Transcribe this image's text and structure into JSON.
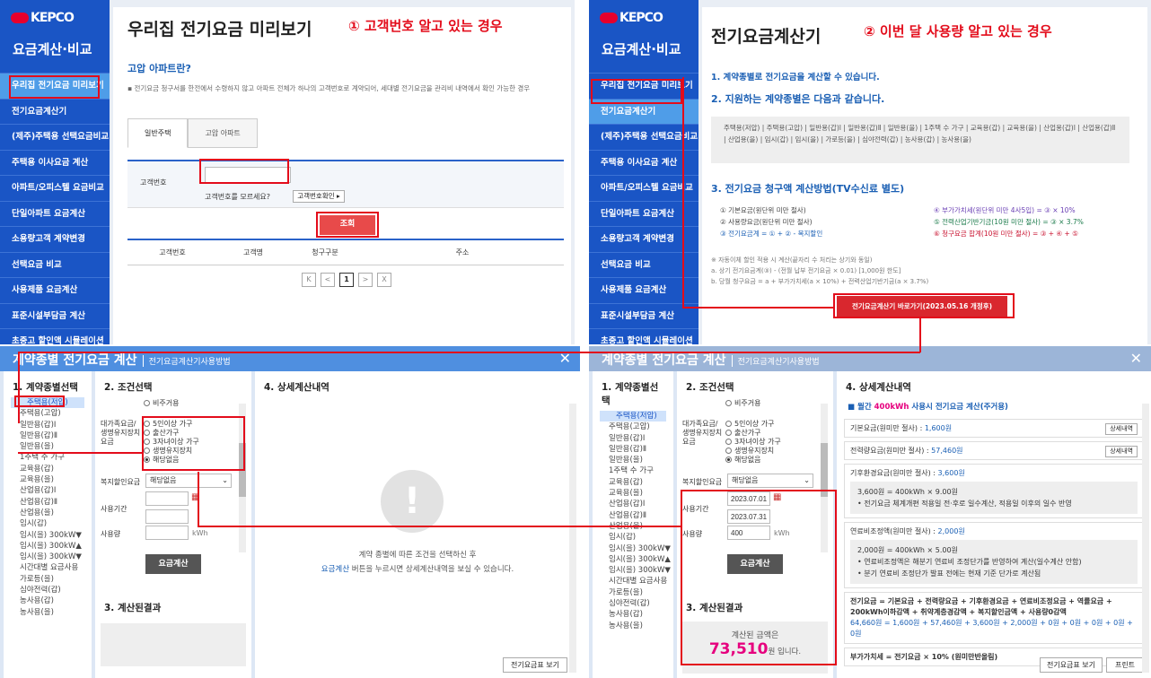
{
  "brand": {
    "logo": "KEPCO",
    "menu_title": "요금계산·비교"
  },
  "left_menu": [
    "우리집 전기요금 미리보기",
    "전기요금계산기",
    "(제주)주택용 선택요금비교",
    "주택용 이사요금 계산",
    "아파트/오피스텔 요금비교",
    "단일아파트 요금계산",
    "소용량고객 계약변경",
    "선택요금 비교",
    "사용제품 요금계산",
    "표준시설부담금 계산",
    "초중고 할인액 시뮬레이션"
  ],
  "right_menu": [
    "우리집 전기요금 미리보기",
    "전기요금계산기",
    "(제주)주택용 선택요금비교",
    "주택용 이사요금 계산",
    "아파트/오피스텔 요금비교",
    "단일아파트 요금계산",
    "소용량고객 계약변경",
    "선택요금 비교",
    "사용제품 요금계산",
    "표준시설부담금 계산",
    "초중고 할인액 시뮬레이션"
  ],
  "p1": {
    "title": "우리집 전기요금 미리보기",
    "callout": "① 고객번호 알고 있는 경우",
    "subtitle": "고압 아파트란?",
    "desc": "▪ 전기요금 청구서를 한전에서 수령하지 않고 아파트 전체가 하나의 고객번호로 계약되어, 세대별 전기요금을 관리비 내역에서 확인 가능한 경우",
    "tabs": [
      "일반주택",
      "고압 아파트"
    ],
    "field_label": "고객번호",
    "hint": "고객번호를 모르세요?",
    "hint_btn": "고객번호확인 ▸",
    "search_btn": "조회",
    "cols": [
      "고객번호",
      "고객명",
      "청구구분",
      "주소"
    ],
    "pager": [
      "K",
      "<",
      "1",
      ">",
      "X"
    ]
  },
  "p2": {
    "title": "전기요금계산기",
    "callout": "② 이번 달 사용량 알고 있는 경우",
    "s1": "1. 계약종별로 전기요금을 계산할 수 있습니다.",
    "s2": "2. 지원하는 계약종별은 다음과 같습니다.",
    "types": "주택용(저압) | 주택용(고압) | 일반용(갑)Ⅰ | 일반용(갑)Ⅱ | 일반용(을) | 1주택 수 가구 | 교육용(갑) | 교육용(을) | 산업용(갑)Ⅰ | 산업용(갑)Ⅱ | 산업용(을) | 임시(갑) | 임시(을) | 가로등(을) | 심야전력(갑) | 농사용(갑) | 농사용(을)",
    "s3": "3. 전기요금 청구액 계산방법(TV수신료 별도)",
    "f1": "① 기본요금(원단위 미만 절사)",
    "f2": "② 사용량요금(원단위 미만 절사)",
    "f3": "③ 전기요금계 = ① + ② - 복지할인",
    "f4": "④ 부가가치세(원단위 미만 4사5입) = ③ × 10%",
    "f5": "⑤ 전력산업기반기금(10원 미만 절사) = ③ × 3.7%",
    "f6": "⑥ 청구요금 합계(10원 미만 절사) = ③ + ④ + ⑤",
    "note1": "※ 자동이체 할인 적용 시 계산(끝자리 수 처리는 상기와 동일)",
    "note2": "a. 상기 전기요금계(③) - (전월 납부 전기요금 × 0.01) [1,000원 한도]",
    "note3": "b. 당월 청구요금 = a + 부가가치세(a × 10%) + 전력산업기반기금(a × 3.7%)",
    "go_btn": "전기요금계산기 바로가기(2023.05.16 개정후)"
  },
  "dlg_left": {
    "title": "계약종별 전기요금 계산",
    "mode": "전기요금계산기사용방법",
    "h1": "1. 계약종별선택",
    "h2": "2. 조건선택",
    "h3": "3. 계산된결과",
    "h4": "4. 상세계산내역",
    "types": [
      "주택용(저압)",
      "주택용(고압)",
      "일반용(갑)Ⅰ",
      "일반용(갑)Ⅱ",
      "일반용(을)",
      "1주택 수 가구",
      "교육용(갑)",
      "교육용(을)",
      "산업용(갑)Ⅰ",
      "산업용(갑)Ⅱ",
      "산업용(을)",
      "임시(갑)",
      "임시(을) 300kW▼",
      "임시(을) 300kW▲",
      "임시(을) 300kW▼",
      "시간대별 요금사용",
      "가로등(을)",
      "심야전력(갑)",
      "농사용(갑)",
      "농사용(을)"
    ],
    "opt_top": "비주거용",
    "cond_label": "대가족요금/생명유지장치요금",
    "opts": [
      "5인이상 가구",
      "출산가구",
      "3자녀이상 가구",
      "생명유지장치",
      "해당없음"
    ],
    "welfare_label": "복지할인요금",
    "welfare_value": "해당없음",
    "period_label": "사용기간",
    "usage_label": "사용량",
    "unit": "kWh",
    "calc_btn": "요금계산",
    "empty_msg1": "계약 종별에 따른 조건을 선택하신 후",
    "empty_link": "요금계산",
    "empty_msg2": " 버튼을 누르시면 상세계산내역을 보실 수 있습니다.",
    "table_btn": "전기요금표 보기"
  },
  "dlg_right": {
    "title": "계약종별 전기요금 계산",
    "mode": "전기요금계산기사용방법",
    "h1": "1. 계약종별선택",
    "h2": "2. 조건선택",
    "h3": "3. 계산된결과",
    "h4": "4. 상세계산내역",
    "types": [
      "주택용(저압)",
      "주택용(고압)",
      "일반용(갑)Ⅰ",
      "일반용(갑)Ⅱ",
      "일반용(을)",
      "1주택 수 가구",
      "교육용(갑)",
      "교육용(을)",
      "산업용(갑)Ⅰ",
      "산업용(갑)Ⅱ",
      "산업용(을)",
      "임시(갑)",
      "임시(을) 300kW▼",
      "임시(을) 300kW▲",
      "임시(을) 300kW▼",
      "시간대별 요금사용",
      "가로등(을)",
      "심야전력(갑)",
      "농사용(갑)",
      "농사용(을)"
    ],
    "opt_top": "비주거용",
    "cond_label": "대가족요금/생명유지장치요금",
    "opts": [
      "5인이상 가구",
      "출산가구",
      "3자녀이상 가구",
      "생명유지장치",
      "해당없음"
    ],
    "welfare_label": "복지할인요금",
    "welfare_value": "해당없음",
    "period_label": "사용기간",
    "date_from": "2023.07.01",
    "date_to": "2023.07.31",
    "usage_label": "사용량",
    "usage_value": "400",
    "unit": "kWh",
    "calc_btn": "요금계산",
    "result_label": "계산된 금액은",
    "result_amount": "73,510",
    "result_suffix": "원 입니다.",
    "d_title_pre": "월간 ",
    "d_title_hl": "400kWh",
    "d_title_post": " 사용시 전기요금 계산(주거용)",
    "d_basic": "기본요금(원미만 절사) : ",
    "d_basic_v": "1,600원",
    "d_energy": "전력량요금(원미만 절사) : ",
    "d_energy_v": "57,460원",
    "detail_btn": "상세내역",
    "d_climate": "기후환경요금(원미만 절사) : ",
    "d_climate_v": "3,600원",
    "d_climate_s1": "3,600원 = 400kWh × 9.00원",
    "d_climate_s2": "• 전기요금 체계개편 적용일 전·후로 일수계산, 적용일 이후의 일수 반영",
    "d_fuel": "연료비조정액(원미만 절사) : ",
    "d_fuel_v": "2,000원",
    "d_fuel_s1": "2,000원 = 400kWh × 5.00원",
    "d_fuel_s2": "• 연료비조정액은 해분기 연료비 조정단가를 반영하여 계산(일수계산 안함)",
    "d_fuel_s3": "• 분기 연료비 조정단가 발표 전에는 현재 기준 단가로 계산됨",
    "d_sum": "전기요금 = 기본요금 + 전력량요금 + 기후환경요금 + 연료비조정요금 + 역률요금 + 200kWh이하감액 + 취약계층경감액 + 복지할인금액 + 사용량0감액",
    "d_sum_v": "64,660원 = 1,600원 + 57,460원 + 3,600원 + 2,000원 + 0원 + 0원 + 0원 + 0원 + 0원",
    "d_vat": "부가가치세 = 전기요금 × 10% (원미만반올림)",
    "table_btn": "전기요금표 보기",
    "print_btn": "프린트"
  }
}
